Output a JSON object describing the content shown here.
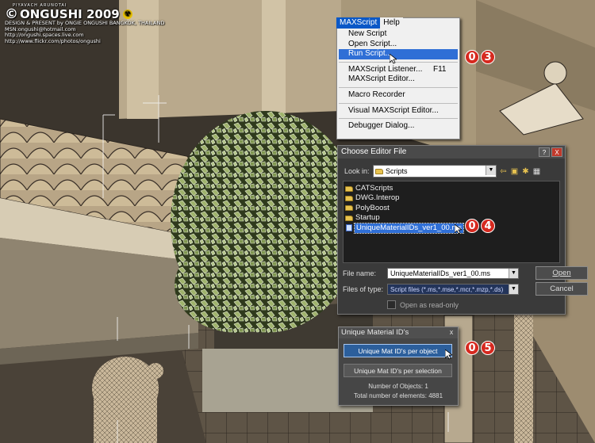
{
  "watermark": {
    "line_top": "PIYAVACH ARUNOTAI",
    "title": "ONGUSHI 2009",
    "copyright_symbol": "©",
    "credit": "DESIGN & PRESENT by ONGIE ONGUSHI   BANGKOK, THAILAND",
    "msn": "MSN:ongushi@hotmail.com",
    "url1": "http://ongushi.spaces.live.com",
    "url2": "http://www.flickr.com/photos/ongushi"
  },
  "menubar": {
    "items": [
      "MAXScript",
      "Help"
    ]
  },
  "menu": {
    "items": [
      {
        "label": "New Script",
        "shortcut": ""
      },
      {
        "label": "Open Script...",
        "shortcut": ""
      },
      {
        "label": "Run Script...",
        "shortcut": "",
        "highlighted": true
      },
      {
        "label": "MAXScript Listener...",
        "shortcut": "F11"
      },
      {
        "label": "MAXScript Editor...",
        "shortcut": ""
      },
      {
        "label": "Macro Recorder",
        "shortcut": ""
      },
      {
        "label": "Visual MAXScript Editor...",
        "shortcut": ""
      },
      {
        "label": "Debugger Dialog...",
        "shortcut": ""
      }
    ]
  },
  "callouts": {
    "step3": [
      "0",
      "3"
    ],
    "step4": [
      "0",
      "4"
    ],
    "step5": [
      "0",
      "5"
    ]
  },
  "dialog": {
    "title": "Choose Editor File",
    "help_btn": "?",
    "close_btn": "X",
    "look_in_label": "Look in:",
    "look_in_value": "Scripts",
    "files": [
      {
        "name": "CATScripts",
        "type": "folder"
      },
      {
        "name": "DWG.Interop",
        "type": "folder"
      },
      {
        "name": "PolyBoost",
        "type": "folder"
      },
      {
        "name": "Startup",
        "type": "folder"
      },
      {
        "name": "UniqueMaterialIDs_ver1_00.ms",
        "type": "file",
        "selected": true
      }
    ],
    "file_name_label": "File name:",
    "file_name_value": "UniqueMaterialIDs_ver1_00.ms",
    "files_of_type_label": "Files of type:",
    "files_of_type_value": "Script files (*.ms,*.mse,*.mcr,*.mzp,*.ds)",
    "open_btn": "Open",
    "cancel_btn": "Cancel",
    "read_only_label": "Open as read-only"
  },
  "panel": {
    "title": "Unique Material ID's",
    "close": "x",
    "btn_per_object": "Unique Mat ID's per object",
    "btn_per_selection": "Unique Mat ID's per selection",
    "num_objects": "Number of Objects: 1",
    "num_elements": "Total number of elements: 4881"
  },
  "colors": {
    "menu_highlight": "#2f6fd6",
    "callout_red": "#d6291f",
    "dialog_bg": "#3a3a3a",
    "panel_active": "#2c5f9c"
  }
}
